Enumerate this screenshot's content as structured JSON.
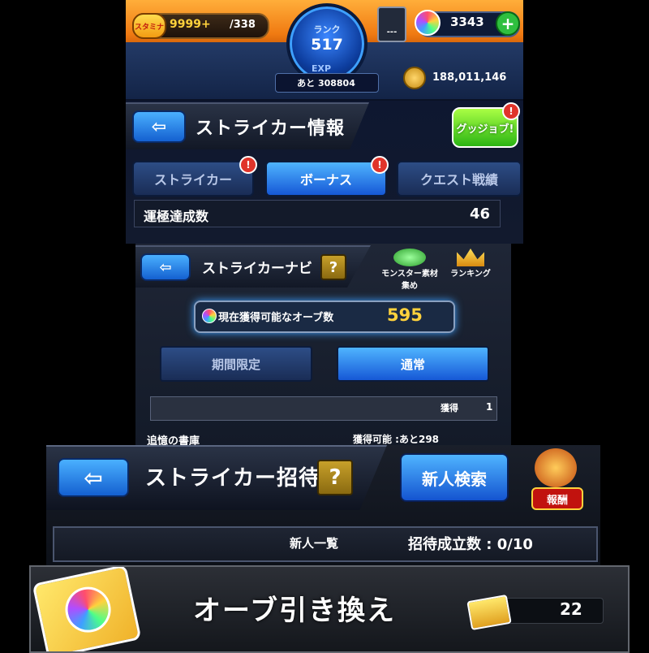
{
  "status": {
    "stamina_label": "スタミナ",
    "stamina_value": "9999+",
    "stamina_max": "/338",
    "rank_label": "ランク",
    "rank_value": "517",
    "exp_label": "EXP",
    "exp_remaining": "あと 308804",
    "lock_value": "---",
    "orbs": "3343",
    "add_orbs_glyph": "+",
    "gold": "188,011,146"
  },
  "striker_info": {
    "title": "ストライカー情報",
    "back_glyph": "⇦",
    "goodjob_label": "グッジョブ!",
    "alert_glyph": "!",
    "tabs": [
      {
        "label": "ストライカー",
        "active": false,
        "alert": true
      },
      {
        "label": "ボーナス",
        "active": true,
        "alert": true
      },
      {
        "label": "クエスト戦績",
        "active": false,
        "alert": false
      }
    ],
    "row_label": "運極達成数",
    "row_value": "46"
  },
  "navi": {
    "title": "ストライカーナビ",
    "help_glyph": "?",
    "monster_label": "モンスター素材集め",
    "ranking_label": "ランキング",
    "orb_count_label": "現在獲得可能なオーブ数",
    "orb_count_value": "595",
    "buttons": [
      {
        "label": "期間限定",
        "active": false
      },
      {
        "label": "通常",
        "active": true
      }
    ],
    "obtained_label": "獲得",
    "obtained_value": "1",
    "row_title": "追憶の書庫",
    "row_available": "獲得可能 :あと298"
  },
  "invite": {
    "title": "ストライカー招待",
    "help_glyph": "?",
    "new_search_label": "新人検索",
    "reward_label": "報酬",
    "list_label": "新人一覧",
    "success_label": "招待成立数 : 0/10"
  },
  "exchange": {
    "title": "オーブ引き換え",
    "ticket_count": "22"
  },
  "colors": {
    "accent_blue": "#1658d6",
    "orange_bar": "#f07a12",
    "gold_text": "#ffd23c"
  }
}
